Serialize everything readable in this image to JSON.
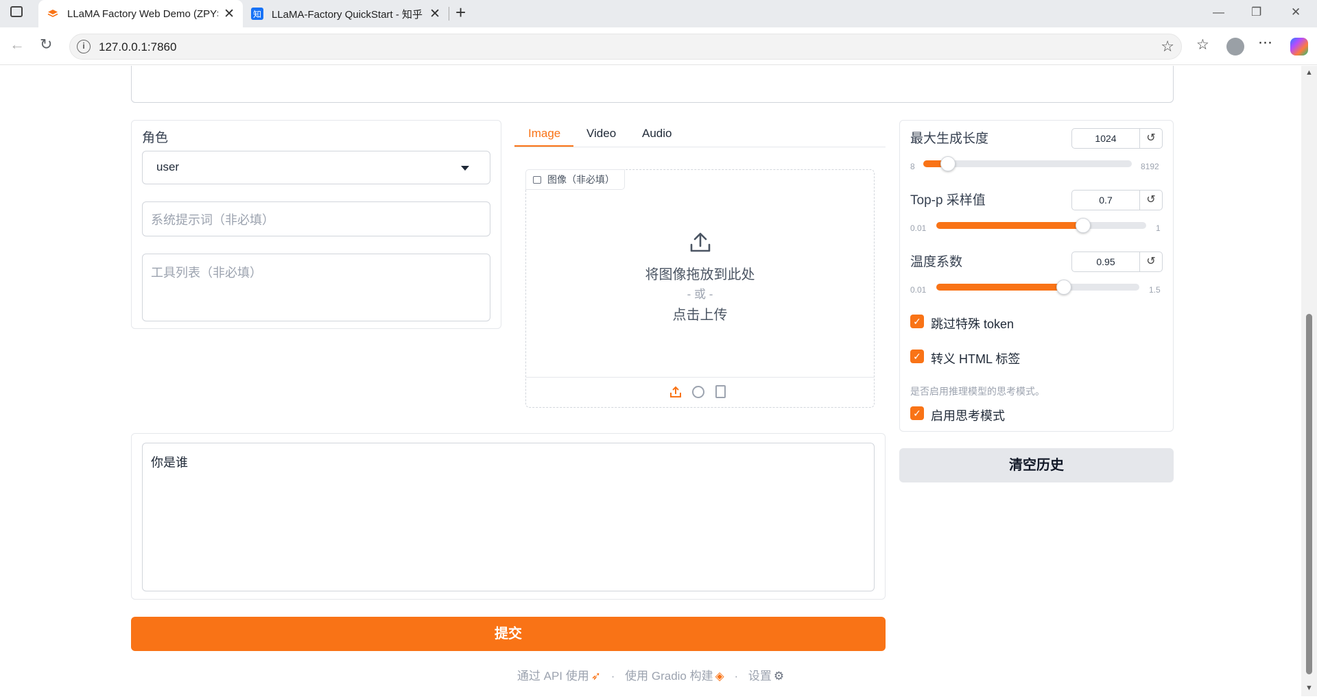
{
  "browser": {
    "tabs": [
      {
        "title": "LLaMA Factory Web Demo (ZPYSe",
        "favicon": "gradio-logo-icon",
        "active": true
      },
      {
        "title": "LLaMA-Factory QuickStart - 知乎",
        "favicon_text": "知",
        "active": false
      }
    ],
    "new_tab": "+",
    "url": "127.0.0.1:7860"
  },
  "left_panel": {
    "role_label": "角色",
    "role_value": "user",
    "system_placeholder": "系统提示词（非必填）",
    "tools_placeholder": "工具列表（非必填）"
  },
  "media": {
    "tabs": [
      "Image",
      "Video",
      "Audio"
    ],
    "active_tab": "Image",
    "image_label": "图像（非必填）",
    "drop_text": "将图像拖放到此处",
    "or_text": "- 或 -",
    "click_text": "点击上传"
  },
  "params": {
    "max_len": {
      "label": "最大生成长度",
      "value": "1024",
      "min": "8",
      "max": "8192",
      "fraction": 0.12
    },
    "top_p": {
      "label": "Top-p 采样值",
      "value": "0.7",
      "min": "0.01",
      "max": "1",
      "fraction": 0.7
    },
    "temperature": {
      "label": "温度系数",
      "value": "0.95",
      "min": "0.01",
      "max": "1.5",
      "fraction": 0.63
    },
    "skip_special": {
      "label": "跳过特殊 token",
      "checked": true
    },
    "escape_html": {
      "label": "转义 HTML 标签",
      "checked": true
    },
    "thinking_info": "是否启用推理模型的思考模式。",
    "thinking": {
      "label": "启用思考模式",
      "checked": true
    }
  },
  "clear_button": "清空历史",
  "message_value": "你是谁",
  "submit_button": "提交",
  "footer": {
    "api": "通过 API 使用",
    "dot": "·",
    "built": "使用 Gradio 构建",
    "settings": "设置"
  },
  "colors": {
    "accent": "#f97316",
    "muted": "#9ca3af"
  }
}
